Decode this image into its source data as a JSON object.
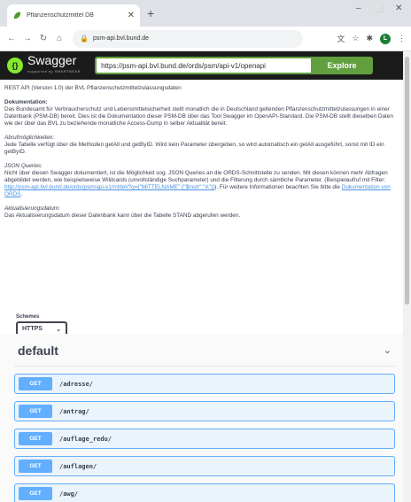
{
  "browser": {
    "tab_title": "Pflanzenschutzmittel DB",
    "url": "psm-api.bvl.bund.de",
    "window_minimize": "–",
    "window_maximize": "⬜",
    "window_close": "✕"
  },
  "header": {
    "logo_text": "Swagger",
    "logo_sub": "supported by SMARTBEAR",
    "url_value": "https://psm-api.bvl.bund.de/ords/psm/api-v1/openapi",
    "explore_label": "Explore"
  },
  "info": {
    "intro": "REST API (Version 1.0) der BVL Pflanzenschutzmittelzulassungsdaten",
    "doc_heading": "Dokumentation:",
    "doc_text": "Das Bundesamt für Verbraucherschutz und Lebensmittelsicherheit stellt monatlich die in Deutschland geltenden Pflanzenschutzmittelzulassungen in einer Datenbank (PSM-DB) bereit. Dies ist die Dokumentation dieser PSM-DB über das Tool Swagger im OpenAPI-Standard. Die PSM-DB stellt dieselben Daten wie der über das BVL zu beziehende monatliche Access-Dump in selber Aktualität bereit.",
    "abruf_heading": "Abrufmöglichkeiten:",
    "abruf_text": "Jede Tabelle verfügt über die Methoden getAll und getByID. Wird kein Parameter übergeben, so wird automatisch ein getAll ausgeführt, sonst mit ID ein getByID.",
    "json_heading": "JSON Queries:",
    "json_text": "Nicht über diesen Swagger dokumentiert, ist die Möglichkeit sog. JSON Queries an die ORDS-Schnittstelle zu senden. Mit diesen können mehr Abfragen abgebildet werden, wie beispielsweise Wildcards (unvollständige Suchparameter) und die Filterung durch sämtliche Parameter. (Beispielaufruf mit Filter:",
    "json_link": "http://psm-api.bvl.bund.de/ords/psm/api-v1/mittel/?q={\"MITTELNAME\":{\"$instr\":\"A\"}}",
    "json_text2": "). Für weitere Informationen beachten Sie bitte die",
    "json_link2": "Dokumentation von ORDS",
    "json_end": ".",
    "aktual_heading": "Aktualisierungsdatum:",
    "aktual_text": "Das Aktualisierungsdatum dieser Datenbank kann über die Tabelle STAND abgerufen werden."
  },
  "schemes": {
    "label": "Schemes",
    "selected": "HTTPS"
  },
  "section": {
    "title": "default",
    "operations": [
      {
        "method": "GET",
        "path": "/adresse/"
      },
      {
        "method": "GET",
        "path": "/antrag/"
      },
      {
        "method": "GET",
        "path": "/auflage_redu/"
      },
      {
        "method": "GET",
        "path": "/auflagen/"
      },
      {
        "method": "GET",
        "path": "/awg/"
      }
    ]
  }
}
